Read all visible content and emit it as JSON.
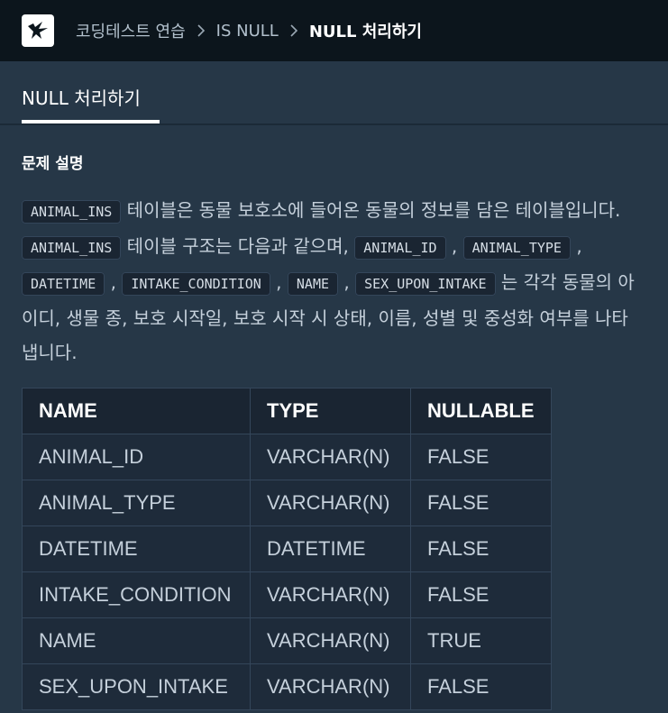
{
  "header": {
    "breadcrumbs": [
      "코딩테스트 연습",
      "IS NULL"
    ],
    "current": "NULL 처리하기"
  },
  "tabs": [
    {
      "label": "NULL 처리하기"
    }
  ],
  "problem": {
    "section_title": "문제 설명",
    "tokens": {
      "table": "ANIMAL_INS",
      "col1": "ANIMAL_ID",
      "col2": "ANIMAL_TYPE",
      "col3": "DATETIME",
      "col4": "INTAKE_CONDITION",
      "col5": "NAME",
      "col6": "SEX_UPON_INTAKE"
    },
    "text": {
      "t1": " 테이블은 동물 보호소에 들어온 동물의 정보를 담은 테이블입니다. ",
      "t2": " 테이블 구조는 다음과 같으며, ",
      "comma": " , ",
      "t3": " 는 각각 동물의 아이디, 생물 종, 보호 시작일, 보호 시작 시 상태, 이름, 성별 및 중성화 여부를 나타냅니다."
    }
  },
  "schema_table": {
    "headers": [
      "NAME",
      "TYPE",
      "NULLABLE"
    ],
    "rows": [
      [
        "ANIMAL_ID",
        "VARCHAR(N)",
        "FALSE"
      ],
      [
        "ANIMAL_TYPE",
        "VARCHAR(N)",
        "FALSE"
      ],
      [
        "DATETIME",
        "DATETIME",
        "FALSE"
      ],
      [
        "INTAKE_CONDITION",
        "VARCHAR(N)",
        "FALSE"
      ],
      [
        "NAME",
        "VARCHAR(N)",
        "TRUE"
      ],
      [
        "SEX_UPON_INTAKE",
        "VARCHAR(N)",
        "FALSE"
      ]
    ]
  },
  "colors": {
    "topbar": "#0c151c",
    "background": "#263747",
    "table_bg": "#1e2b3a",
    "code_bg": "#1a2532"
  },
  "icons": {
    "logo": "programmers-logo-icon",
    "separator": "chevron-right-icon"
  }
}
